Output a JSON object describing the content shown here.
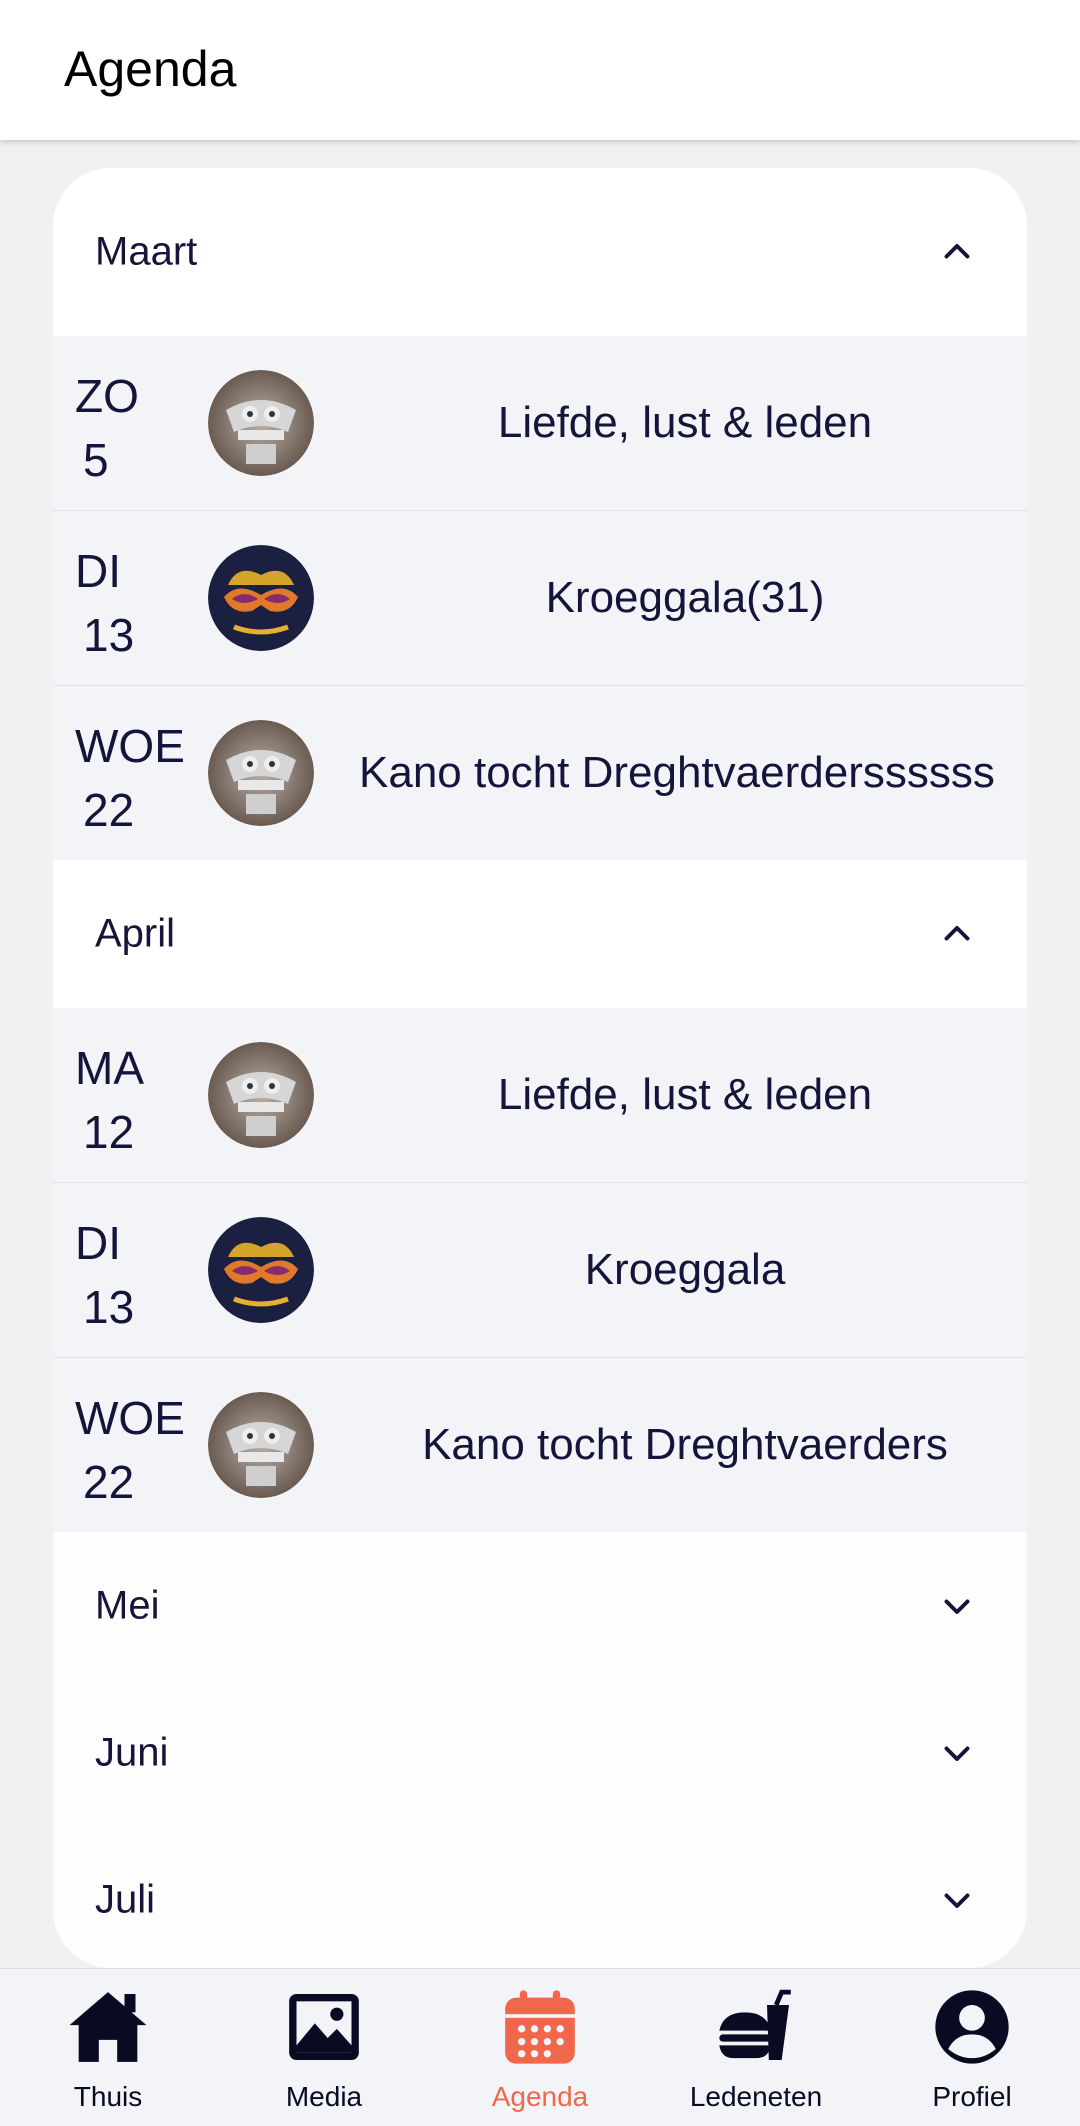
{
  "header": {
    "title": "Agenda"
  },
  "months": [
    {
      "name": "Maart",
      "expanded": true,
      "events": [
        {
          "day": "ZO",
          "date": "5",
          "title": "Liefde, lust & leden",
          "image": "owl-logo"
        },
        {
          "day": "DI",
          "date": "13",
          "title": "Kroeggala(31)",
          "image": "masquerade-logo"
        },
        {
          "day": "WOE",
          "date": "22",
          "title": "Kano tocht Dreghtvaerderssssss",
          "image": "owl-logo"
        }
      ]
    },
    {
      "name": "April",
      "expanded": true,
      "events": [
        {
          "day": "MA",
          "date": "12",
          "title": "Liefde, lust & leden",
          "image": "owl-logo"
        },
        {
          "day": "DI",
          "date": "13",
          "title": "Kroeggala",
          "image": "masquerade-logo"
        },
        {
          "day": "WOE",
          "date": "22",
          "title": "Kano tocht Dreghtvaerders",
          "image": "owl-logo"
        }
      ]
    },
    {
      "name": "Mei",
      "expanded": false
    },
    {
      "name": "Juni",
      "expanded": false
    },
    {
      "name": "Juli",
      "expanded": false
    }
  ],
  "nav": [
    {
      "label": "Thuis",
      "icon": "home-icon"
    },
    {
      "label": "Media",
      "icon": "image-icon"
    },
    {
      "label": "Agenda",
      "icon": "calendar-icon",
      "active": true
    },
    {
      "label": "Ledeneten",
      "icon": "food-icon"
    },
    {
      "label": "Profiel",
      "icon": "profile-icon"
    }
  ],
  "colors": {
    "accent": "#f0674c",
    "text": "#16143a",
    "eventBg": "#f3f4f8"
  }
}
